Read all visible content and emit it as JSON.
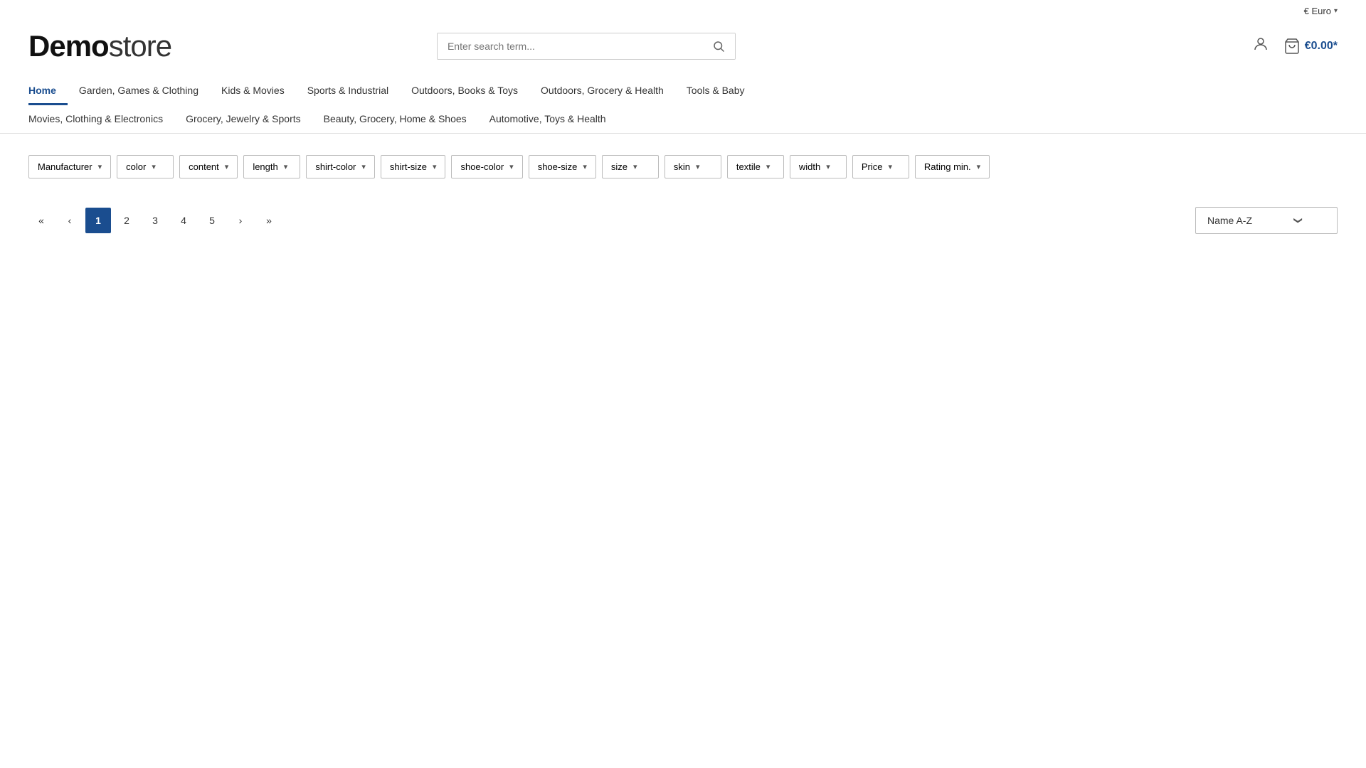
{
  "topbar": {
    "currency_label": "€ Euro",
    "currency_chevron": "▾"
  },
  "header": {
    "logo_bold": "Demo",
    "logo_light": "store",
    "search_placeholder": "Enter search term...",
    "cart_price": "€0.00*"
  },
  "nav": {
    "row1": [
      {
        "label": "Home",
        "active": true
      },
      {
        "label": "Garden, Games & Clothing",
        "active": false
      },
      {
        "label": "Kids & Movies",
        "active": false
      },
      {
        "label": "Sports & Industrial",
        "active": false
      },
      {
        "label": "Outdoors, Books & Toys",
        "active": false
      },
      {
        "label": "Outdoors, Grocery & Health",
        "active": false
      },
      {
        "label": "Tools & Baby",
        "active": false
      }
    ],
    "row2": [
      {
        "label": "Movies, Clothing & Electronics",
        "active": false
      },
      {
        "label": "Grocery, Jewelry & Sports",
        "active": false
      },
      {
        "label": "Beauty, Grocery, Home & Shoes",
        "active": false
      },
      {
        "label": "Automotive, Toys & Health",
        "active": false
      }
    ]
  },
  "filters": [
    {
      "label": "Manufacturer"
    },
    {
      "label": "color"
    },
    {
      "label": "content"
    },
    {
      "label": "length"
    },
    {
      "label": "shirt-color"
    },
    {
      "label": "shirt-size"
    },
    {
      "label": "shoe-color"
    },
    {
      "label": "shoe-size"
    },
    {
      "label": "size"
    },
    {
      "label": "skin"
    },
    {
      "label": "textile"
    },
    {
      "label": "width"
    },
    {
      "label": "Price"
    },
    {
      "label": "Rating min."
    }
  ],
  "pagination": {
    "first_label": "«",
    "prev_label": "‹",
    "next_label": "›",
    "last_label": "»",
    "pages": [
      "1",
      "2",
      "3",
      "4",
      "5"
    ],
    "active_page": "1"
  },
  "sort": {
    "label": "Name A-Z",
    "chevron": "❯"
  }
}
